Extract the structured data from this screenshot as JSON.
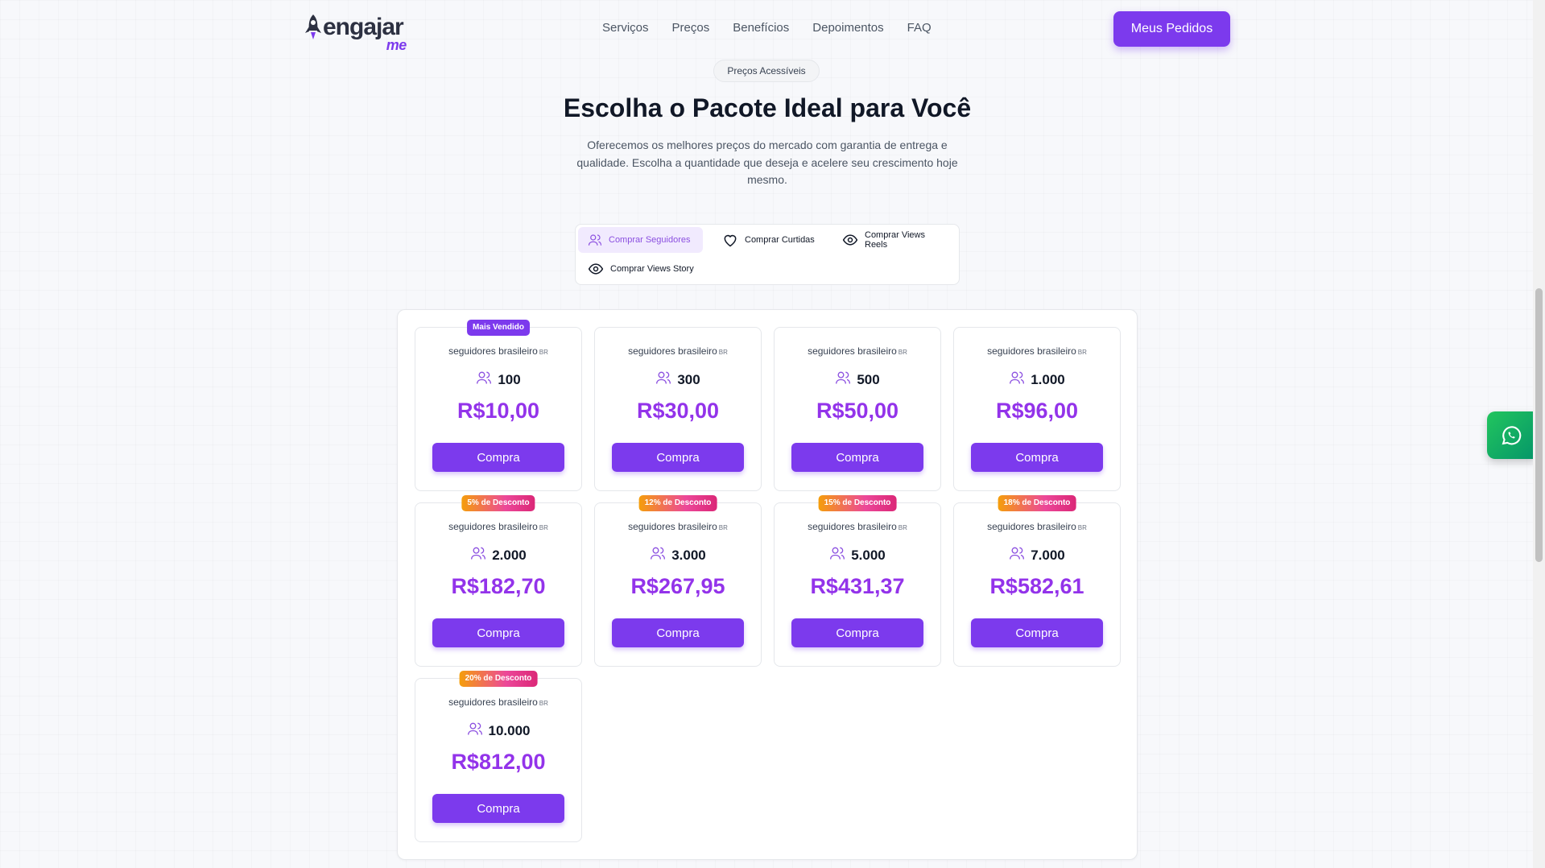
{
  "header": {
    "logo_text": "engajar",
    "logo_suffix": "me",
    "nav": [
      "Serviços",
      "Preços",
      "Benefícios",
      "Depoimentos",
      "FAQ"
    ],
    "orders_button": "Meus Pedidos"
  },
  "hero": {
    "pill": "Preços Acessíveis",
    "title": "Escolha o Pacote Ideal para Você",
    "subtitle": "Oferecemos os melhores preços do mercado com garantia de entrega e qualidade. Escolha a quantidade que deseja e acelere seu crescimento hoje mesmo."
  },
  "tabs": [
    {
      "label": "Comprar Seguidores",
      "icon": "users-icon",
      "active": true
    },
    {
      "label": "Comprar Curtidas",
      "icon": "heart-icon",
      "active": false
    },
    {
      "label": "Comprar Views Reels",
      "icon": "eye-icon",
      "active": false
    },
    {
      "label": "Comprar Views Story",
      "icon": "eye-icon",
      "active": false
    }
  ],
  "packages": [
    {
      "badge": "Mais Vendido",
      "label": "seguidores brasileiro",
      "tag": "BR",
      "qty": "100",
      "price": "R$10,00",
      "button": "Compra"
    },
    {
      "badge": "",
      "label": "seguidores brasileiro",
      "tag": "BR",
      "qty": "300",
      "price": "R$30,00",
      "button": "Compra"
    },
    {
      "badge": "",
      "label": "seguidores brasileiro",
      "tag": "BR",
      "qty": "500",
      "price": "R$50,00",
      "button": "Compra"
    },
    {
      "badge": "",
      "label": "seguidores brasileiro",
      "tag": "BR",
      "qty": "1.000",
      "price": "R$96,00",
      "button": "Compra"
    },
    {
      "badge": "5% de Desconto",
      "label": "seguidores brasileiro",
      "tag": "BR",
      "qty": "2.000",
      "price": "R$182,70",
      "button": "Compra"
    },
    {
      "badge": "12% de Desconto",
      "label": "seguidores brasileiro",
      "tag": "BR",
      "qty": "3.000",
      "price": "R$267,95",
      "button": "Compra"
    },
    {
      "badge": "15% de Desconto",
      "label": "seguidores brasileiro",
      "tag": "BR",
      "qty": "5.000",
      "price": "R$431,37",
      "button": "Compra"
    },
    {
      "badge": "18% de Desconto",
      "label": "seguidores brasileiro",
      "tag": "BR",
      "qty": "7.000",
      "price": "R$582,61",
      "button": "Compra"
    },
    {
      "badge": "20% de Desconto",
      "label": "seguidores brasileiro",
      "tag": "BR",
      "qty": "10.000",
      "price": "R$812,00",
      "button": "Compra"
    }
  ],
  "colors": {
    "accent": "#7c3aed",
    "price": "#9333ea",
    "whatsapp": "#22c55e"
  }
}
